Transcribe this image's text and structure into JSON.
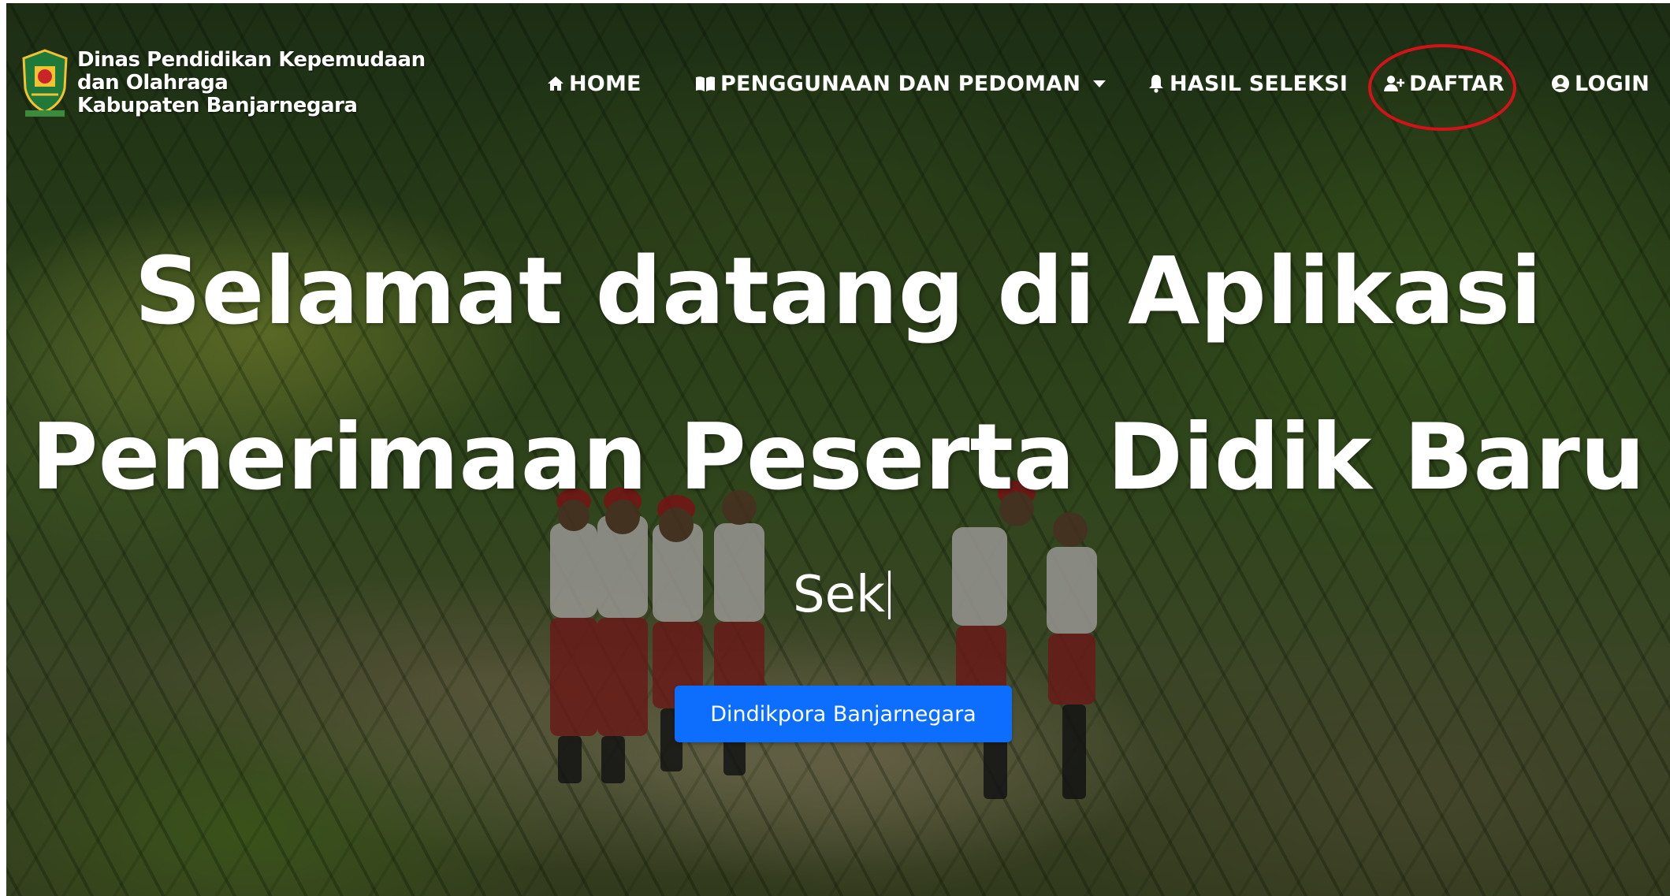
{
  "header": {
    "brand_lines": [
      "Dinas Pendidikan Kepemudaan",
      "dan Olahraga",
      "Kabupaten Banjarnegara"
    ],
    "logo_icon": "regency-crest-icon"
  },
  "nav": {
    "items": [
      {
        "label": "HOME",
        "icon": "home-icon"
      },
      {
        "label": "PENGGUNAAN DAN PEDOMAN",
        "icon": "book-icon",
        "has_dropdown": true
      },
      {
        "label": "HASIL SELEKSI",
        "icon": "bell-icon"
      },
      {
        "label": "DAFTAR",
        "icon": "user-plus-icon",
        "highlighted": true
      },
      {
        "label": "LOGIN",
        "icon": "user-circle-icon"
      }
    ],
    "highlight_color": "#d4121a"
  },
  "hero": {
    "title_line1": "Selamat datang di Aplikasi",
    "title_line2": "Penerimaan Peserta Didik Baru",
    "typing_text": "Sek",
    "cta_label": "Dindikpora Banjarnegara",
    "cta_color": "#0d6efd"
  }
}
